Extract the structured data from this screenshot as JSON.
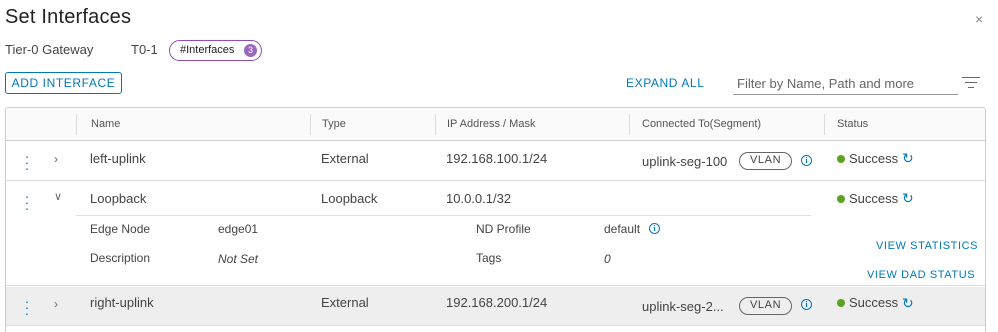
{
  "dialog": {
    "title": "Set Interfaces",
    "close_glyph": "×"
  },
  "context": {
    "gateway_label": "Tier-0 Gateway",
    "gateway_value": "T0-1",
    "pill_label": "#Interfaces",
    "pill_count": "3"
  },
  "toolbar": {
    "add_label": "ADD INTERFACE",
    "expand_label": "EXPAND ALL",
    "filter_placeholder": "Filter by Name, Path and more"
  },
  "table": {
    "columns": [
      "Name",
      "Type",
      "IP Address / Mask",
      "Connected To(Segment)",
      "Status"
    ],
    "rows": [
      {
        "name": "left-uplink",
        "type": "External",
        "ip": "192.168.100.1/24",
        "segment": "uplink-seg-100",
        "badge": "VLAN",
        "status": "Success",
        "expanded": false
      },
      {
        "name": "Loopback",
        "type": "Loopback",
        "ip": "10.0.0.1/32",
        "segment": "",
        "badge": "",
        "status": "Success",
        "expanded": true,
        "details": {
          "edge_node_label": "Edge Node",
          "edge_node_value": "edge01",
          "description_label": "Description",
          "description_value": "Not Set",
          "nd_profile_label": "ND Profile",
          "nd_profile_value": "default",
          "tags_label": "Tags",
          "tags_value": "0",
          "view_statistics": "VIEW STATISTICS",
          "view_dad_status": "VIEW DAD STATUS"
        }
      },
      {
        "name": "right-uplink",
        "type": "External",
        "ip": "192.168.200.1/24",
        "segment": "uplink-seg-2...",
        "badge": "VLAN",
        "status": "Success",
        "expanded": false
      }
    ]
  },
  "icons": {
    "row_actions": "vertical-dots-icon",
    "expand": "chevron-right-icon",
    "collapse": "chevron-down-icon",
    "info": "info-icon",
    "refresh": "refresh-icon",
    "filter": "filter-lines-icon",
    "close": "close-icon"
  },
  "colors": {
    "accent": "#0079b8",
    "pill_border": "#8c4fb4",
    "pill_badge": "#9a66bf",
    "success": "#5aa220"
  }
}
